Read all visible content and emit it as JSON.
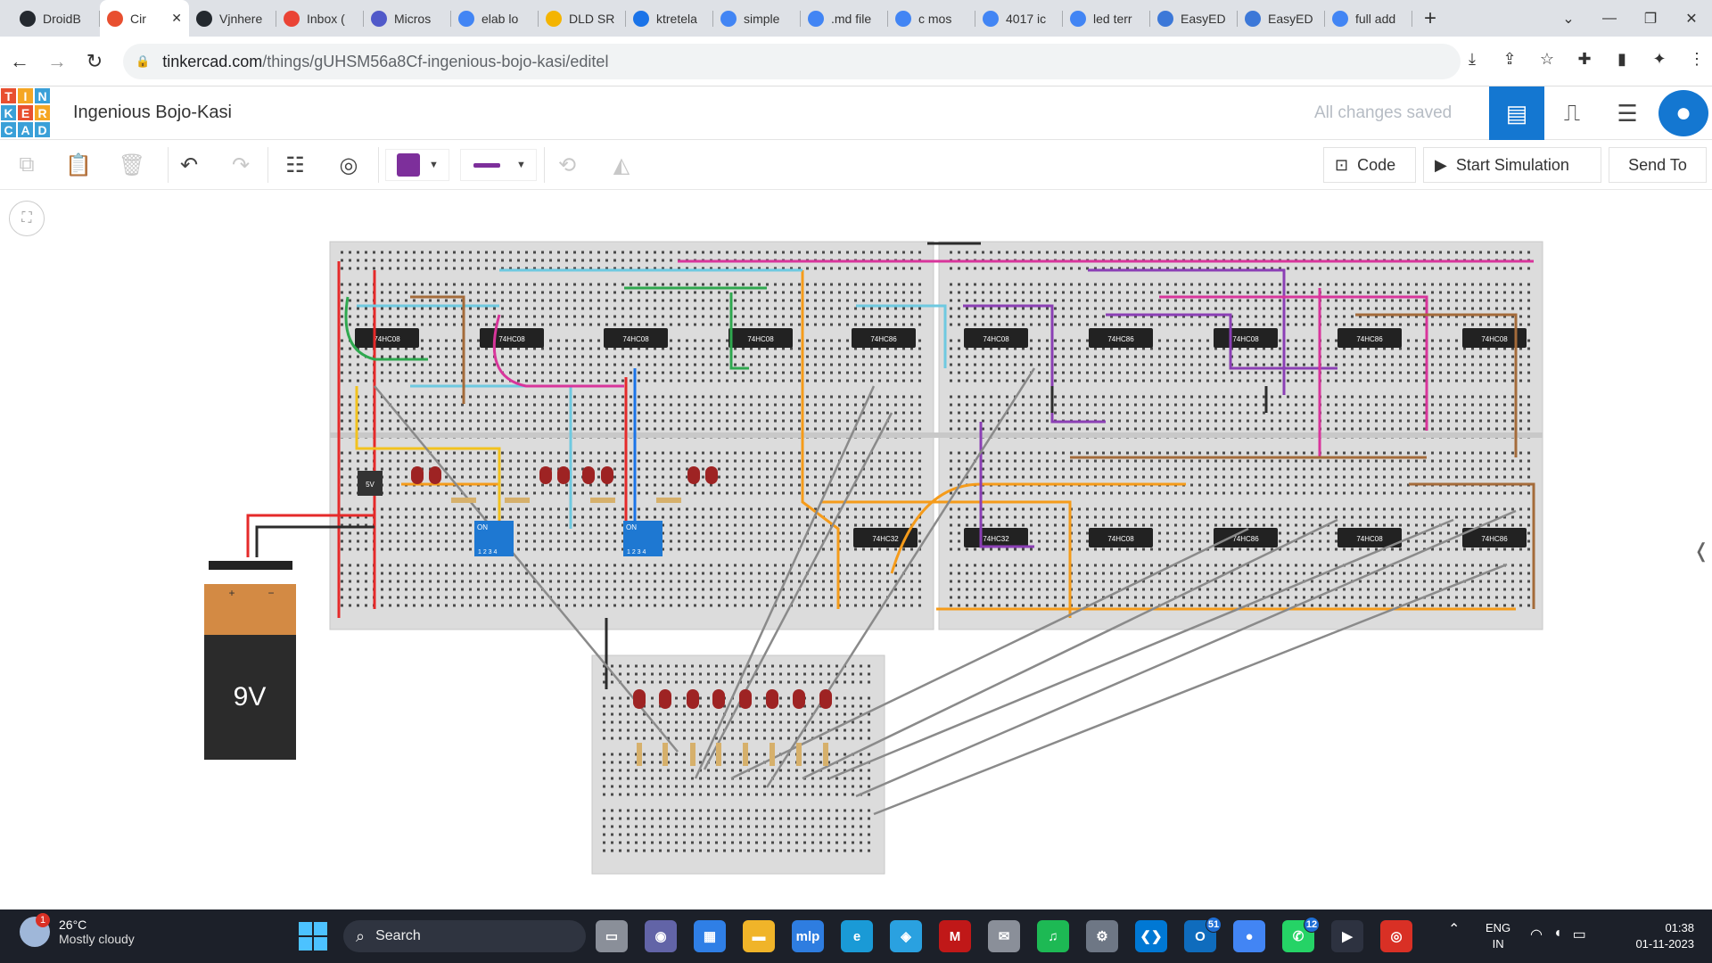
{
  "browser": {
    "tabs": [
      {
        "label": "DroidB",
        "icon": "github-icon",
        "color": "#24292f"
      },
      {
        "label": "Cir",
        "icon": "tinkercad-icon",
        "color": "#e84f30",
        "active": true
      },
      {
        "label": "Vjnhere",
        "icon": "github-icon",
        "color": "#24292f"
      },
      {
        "label": "Inbox (",
        "icon": "gmail-icon",
        "color": "#ea4335"
      },
      {
        "label": "Micros",
        "icon": "teams-icon",
        "color": "#5059c9"
      },
      {
        "label": "elab lo",
        "icon": "google-icon",
        "color": "#4285f4"
      },
      {
        "label": "DLD SR",
        "icon": "person-icon",
        "color": "#f4b400"
      },
      {
        "label": "ktretela",
        "icon": "code-icon",
        "color": "#1a73e8"
      },
      {
        "label": "simple",
        "icon": "google-icon",
        "color": "#4285f4"
      },
      {
        "label": ".md file",
        "icon": "google-icon",
        "color": "#4285f4"
      },
      {
        "label": "c mos",
        "icon": "google-icon",
        "color": "#4285f4"
      },
      {
        "label": "4017 ic",
        "icon": "google-icon",
        "color": "#4285f4"
      },
      {
        "label": "led terr",
        "icon": "google-icon",
        "color": "#4285f4"
      },
      {
        "label": "EasyED",
        "icon": "easyeda-icon",
        "color": "#3c78d8"
      },
      {
        "label": "EasyED",
        "icon": "easyeda-icon",
        "color": "#3c78d8"
      },
      {
        "label": "full add",
        "icon": "google-icon",
        "color": "#4285f4"
      }
    ],
    "new_tab": "+",
    "url_domain": "tinkercad.com",
    "url_path": "/things/gUHSM56a8Cf-ingenious-bojo-kasi/editel"
  },
  "tinkercad": {
    "logo": [
      "T",
      "I",
      "N",
      "K",
      "E",
      "R",
      "C",
      "A",
      "D"
    ],
    "logo_colors": [
      "#e84f30",
      "#f5a623",
      "#3aa0d8",
      "#3aa0d8",
      "#e84f30",
      "#f5a623",
      "#3aa0d8",
      "#3aa0d8",
      "#3aa0d8"
    ],
    "project_title": "Ingenious Bojo-Kasi",
    "save_status": "All changes saved",
    "code_label": "Code",
    "simulate_label": "Start Simulation",
    "send_label": "Send To",
    "wire_color": "#7d2f9b"
  },
  "circuit": {
    "battery_label": "9V",
    "battery_plus": "+",
    "battery_minus": "−",
    "regulator_label": "5V",
    "dip_label": "ON",
    "dip_numbers": "1 2 3 4",
    "chips_top": [
      "74HC08",
      "74HC08",
      "74HC08",
      "74HC08",
      "74HC86",
      "74HC08",
      "74HC86",
      "74HC08",
      "74HC86",
      "74HC08"
    ],
    "chips_bottom": [
      "74HC32",
      "74HC32",
      "74HC08",
      "74HC86",
      "74HC08",
      "74HC86"
    ]
  },
  "taskbar": {
    "weather_temp": "26°C",
    "weather_desc": "Mostly cloudy",
    "weather_badge": "1",
    "search_label": "Search",
    "apps": [
      {
        "name": "file-explorer-app",
        "glyph": "▭",
        "color": "#8a8f99"
      },
      {
        "name": "meet-app",
        "glyph": "◉",
        "color": "#6264a7"
      },
      {
        "name": "store-app",
        "glyph": "▦",
        "color": "#2f7fe6"
      },
      {
        "name": "folder-app",
        "glyph": "▬",
        "color": "#f0b429"
      },
      {
        "name": "mylp-app",
        "glyph": "mlp",
        "color": "#2e7de0"
      },
      {
        "name": "edge-app",
        "glyph": "e",
        "color": "#1a9ad6"
      },
      {
        "name": "fan-app",
        "glyph": "◈",
        "color": "#2aa1e0"
      },
      {
        "name": "mcafee-app",
        "glyph": "M",
        "color": "#c01818"
      },
      {
        "name": "mail-app",
        "glyph": "✉",
        "color": "#8a8f99"
      },
      {
        "name": "spotify-app",
        "glyph": "♫",
        "color": "#1db954"
      },
      {
        "name": "settings-app",
        "glyph": "⚙",
        "color": "#6e7785"
      },
      {
        "name": "vscode-app",
        "glyph": "❮❯",
        "color": "#0078d4"
      },
      {
        "name": "outlook-app",
        "glyph": "O",
        "color": "#0f6cbd",
        "badge": "51"
      },
      {
        "name": "chrome-app",
        "glyph": "●",
        "color": "#4285f4"
      },
      {
        "name": "whatsapp-app",
        "glyph": "✆",
        "color": "#25d366",
        "badge": "12"
      },
      {
        "name": "media-app",
        "glyph": "▶",
        "color": "#2d3240"
      },
      {
        "name": "record-app",
        "glyph": "◎",
        "color": "#d93025"
      }
    ],
    "lang_1": "ENG",
    "lang_2": "IN",
    "time": "01:38",
    "date": "01-11-2023"
  }
}
